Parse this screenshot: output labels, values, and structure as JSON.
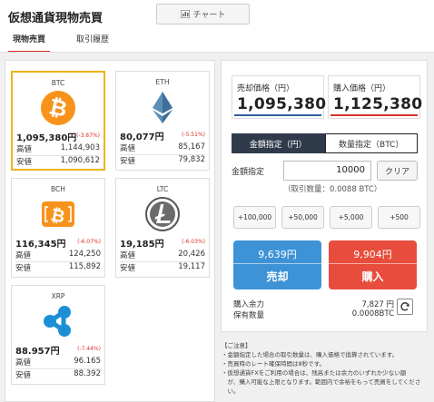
{
  "header": {
    "title": "仮想通貨現物売買",
    "chart_button": "チャート",
    "chart_icon": "bar-chart-icon"
  },
  "tabs": {
    "active": "現物売買",
    "history": "取引履歴"
  },
  "coins": [
    {
      "symbol": "BTC",
      "price": "1,095,380円",
      "change": "(-3.87%)",
      "high_label": "高値",
      "high": "1,144,903",
      "low_label": "安値",
      "low": "1,090,612"
    },
    {
      "symbol": "ETH",
      "price": "80,077円",
      "change": "(-5.51%)",
      "high_label": "高値",
      "high": "85,167",
      "low_label": "安値",
      "low": "79,832"
    },
    {
      "symbol": "BCH",
      "price": "116,345円",
      "change": "(-6.07%)",
      "high_label": "高値",
      "high": "124,250",
      "low_label": "安値",
      "low": "115,892"
    },
    {
      "symbol": "LTC",
      "price": "19,185円",
      "change": "(-6.03%)",
      "high_label": "高値",
      "high": "20,426",
      "low_label": "安値",
      "low": "19,117"
    },
    {
      "symbol": "XRP",
      "price": "88.957円",
      "change": "(-7.44%)",
      "high_label": "高値",
      "high": "96.165",
      "low_label": "安値",
      "low": "88.392"
    }
  ],
  "trade": {
    "sell_label": "売却価格（円）",
    "sell_value": "1,095,380",
    "buy_label": "購入価格（円）",
    "buy_value": "1,125,380",
    "mode_amount": "金額指定（円）",
    "mode_qty": "数量指定（BTC）",
    "amount_label": "金額指定",
    "amount_value": "10000",
    "clear": "クリア",
    "amount_note": "（取引数量：0.0088 BTC）",
    "increments": [
      "+100,000",
      "+50,000",
      "+5,000",
      "+500"
    ],
    "sell_btn_price": "9,639円",
    "sell_btn_label": "売却",
    "buy_btn_price": "9,904円",
    "buy_btn_label": "購入",
    "capacity_label": "購入余力",
    "capacity_value": "7,827 円",
    "holding_label": "保有数量",
    "holding_value": "0.0008BTC"
  },
  "notes": [
    "【ご注意】",
    "・金額指定した場合の取引数量は、購入価格で換算されています。",
    "・売買時のレート確保時間は8秒です。",
    "・仮想通貨FXをご利用の場合は、残高または余力のいずれか少ない額",
    "　が、購入可能な上限となります。範囲内で余裕をもって売買をしてくださ",
    "　い。"
  ],
  "colors": {
    "accent_red": "#d9302b",
    "sell_blue": "#3d93d6",
    "buy_red": "#e74c3c",
    "btc_orange": "#f7931a",
    "card_highlight": "#f0b31a"
  }
}
